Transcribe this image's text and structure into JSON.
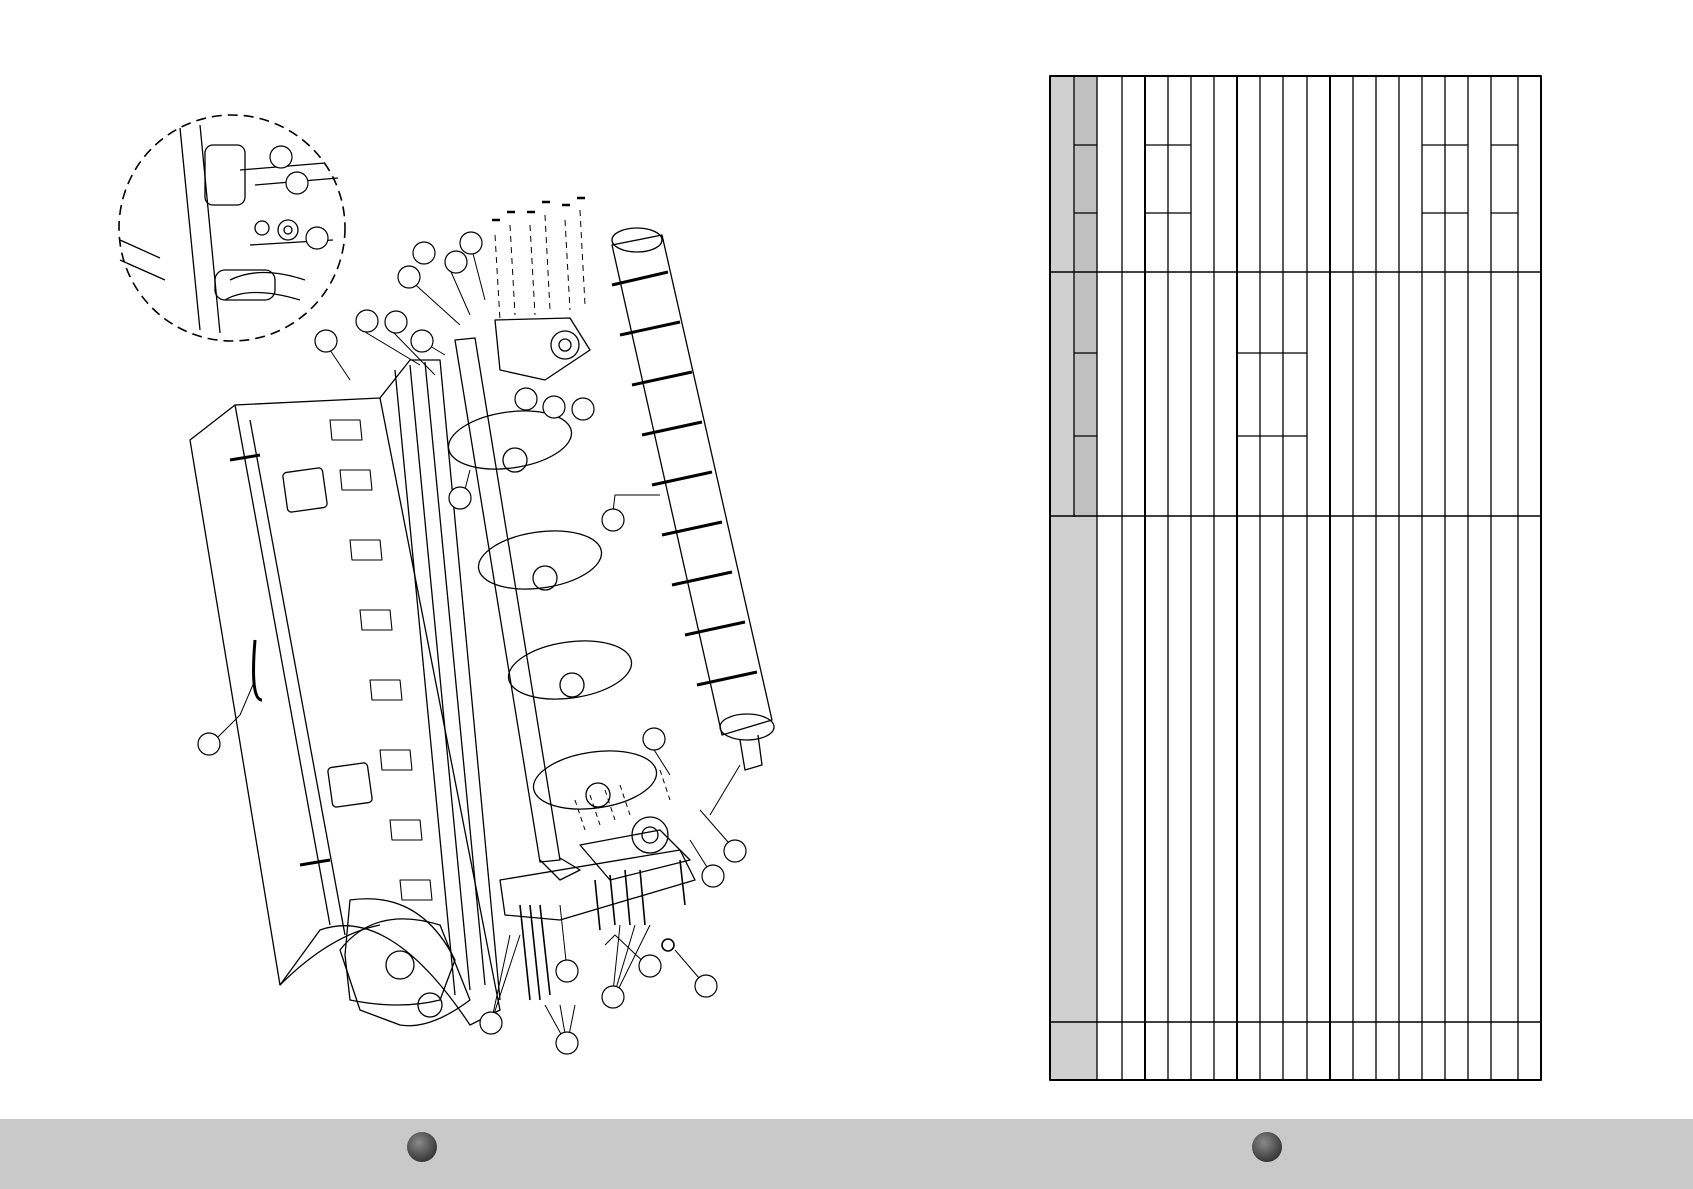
{
  "figure": {
    "type": "exploded-assembly-drawing",
    "components": [
      "detail-circle",
      "rotor-frame",
      "front-shaft",
      "disc-blades",
      "roller",
      "gearbox-housing",
      "side-plate",
      "bolts",
      "callout-bubbles"
    ]
  },
  "parts_table": {
    "columns": 21,
    "rows": "blank",
    "header_color": "#d0d0d0"
  },
  "footer": {
    "background": "#c9c9c9",
    "page_markers": [
      "left-page-dot",
      "right-page-dot"
    ]
  }
}
